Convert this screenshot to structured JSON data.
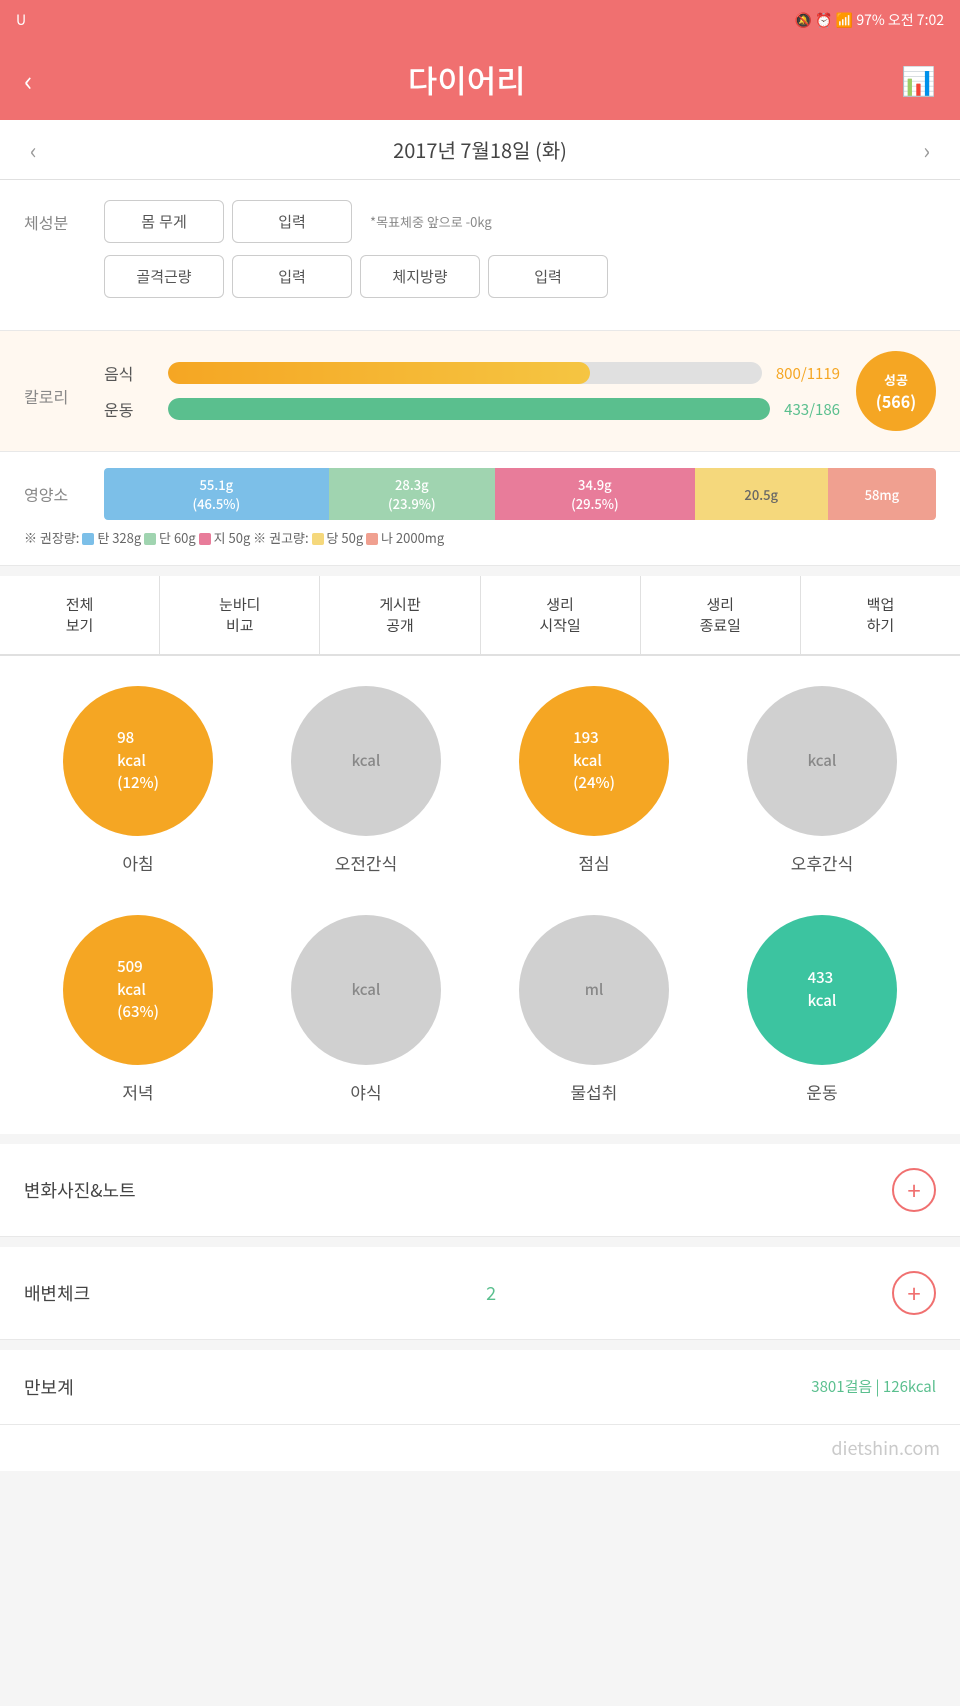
{
  "statusBar": {
    "logo": "U",
    "icons": "🔕 ⏰ 📶 97% 오전 7:02"
  },
  "header": {
    "back": "‹",
    "title": "다이어리",
    "chartIcon": "📊"
  },
  "dateNav": {
    "prev": "‹",
    "date": "2017년 7월18일 (화)",
    "next": "›"
  },
  "bodySection": {
    "label": "체성분",
    "row1": {
      "btn1": "몸 무게",
      "btn2": "입력",
      "goalText": "*목표체중 앞으로 -0kg"
    },
    "row2": {
      "btn1": "골격근량",
      "btn2": "입력",
      "btn3": "체지방량",
      "btn4": "입력"
    }
  },
  "calorieSection": {
    "label": "칼로리",
    "foodLabel": "음식",
    "foodVal": "800/1119",
    "exerciseLabel": "운동",
    "exerciseVal": "433/186",
    "badge": {
      "label": "성공",
      "val": "(566)"
    }
  },
  "nutritionSection": {
    "label": "영양소",
    "segments": [
      {
        "label": "55.1g\n(46.5%)",
        "pct": 27,
        "cls": "nut-carb"
      },
      {
        "label": "28.3g\n(23.9%)",
        "pct": 20,
        "cls": "nut-protein"
      },
      {
        "label": "34.9g\n(29.5%)",
        "pct": 24,
        "cls": "nut-fat"
      },
      {
        "label": "20.5g",
        "pct": 16,
        "cls": "nut-sugar"
      },
      {
        "label": "58mg",
        "pct": 13,
        "cls": "nut-sodium"
      }
    ],
    "note1": "※ 권장량: ■탄 328g ■단 60g ■지 50g ※ 권고량: ■당 50g ■나 2000mg"
  },
  "actionButtons": [
    {
      "label": "전체\n보기"
    },
    {
      "label": "눈바디\n비교"
    },
    {
      "label": "게시판\n공개"
    },
    {
      "label": "생리\n시작일"
    },
    {
      "label": "생리\n종료일"
    },
    {
      "label": "백업\n하기"
    }
  ],
  "meals": [
    {
      "name": "아침",
      "kcal": "98\nkcal\n(12%)",
      "type": "orange"
    },
    {
      "name": "오전간식",
      "kcal": "kcal",
      "type": "gray"
    },
    {
      "name": "점심",
      "kcal": "193\nkcal\n(24%)",
      "type": "orange"
    },
    {
      "name": "오후간식",
      "kcal": "kcal",
      "type": "gray"
    },
    {
      "name": "저녁",
      "kcal": "509\nkcal\n(63%)",
      "type": "orange"
    },
    {
      "name": "야식",
      "kcal": "kcal",
      "type": "gray"
    },
    {
      "name": "물섭취",
      "kcal": "ml",
      "type": "gray"
    },
    {
      "name": "운동",
      "kcal": "433\nkcal",
      "type": "teal"
    }
  ],
  "photoNote": {
    "title": "변화사진&노트"
  },
  "bowelCheck": {
    "title": "배변체크",
    "value": "2"
  },
  "pedometer": {
    "title": "만보계",
    "value": "3801걸음 | 126kcal"
  },
  "watermark": "dietshin.com"
}
